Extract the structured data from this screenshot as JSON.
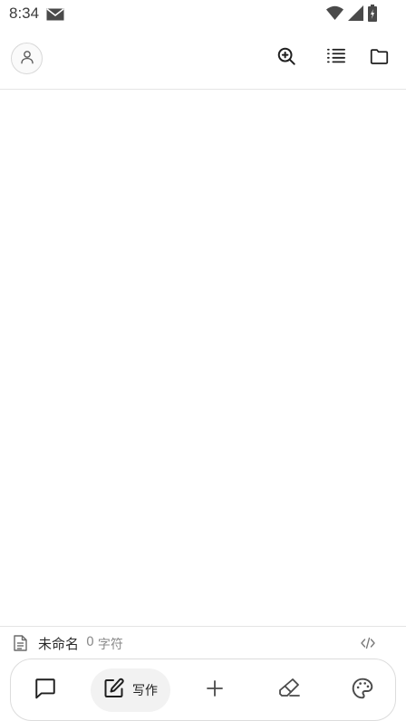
{
  "status_bar": {
    "time": "8:34",
    "icons": [
      "mail-icon",
      "wifi-icon",
      "signal-icon",
      "battery-charging-icon"
    ]
  },
  "header": {
    "avatar_icon": "user-icon",
    "actions": [
      "search-zoom-icon",
      "outline-list-icon",
      "folder-icon"
    ]
  },
  "document": {
    "name": "未命名",
    "count": "0",
    "count_unit": "字符",
    "code_toggle_icon": "code-icon"
  },
  "bottom_nav": {
    "chat_icon": "chat-icon",
    "write_label": "写作",
    "write_icon": "edit-icon",
    "add_icon": "plus-icon",
    "highlight_icon": "highlighter-icon",
    "palette_icon": "palette-icon"
  },
  "colors": {
    "icon": "#1f1f1f",
    "muted_text": "#8a8a8a",
    "divider": "#e4e4e4",
    "active_pill": "#f2f2f2"
  }
}
